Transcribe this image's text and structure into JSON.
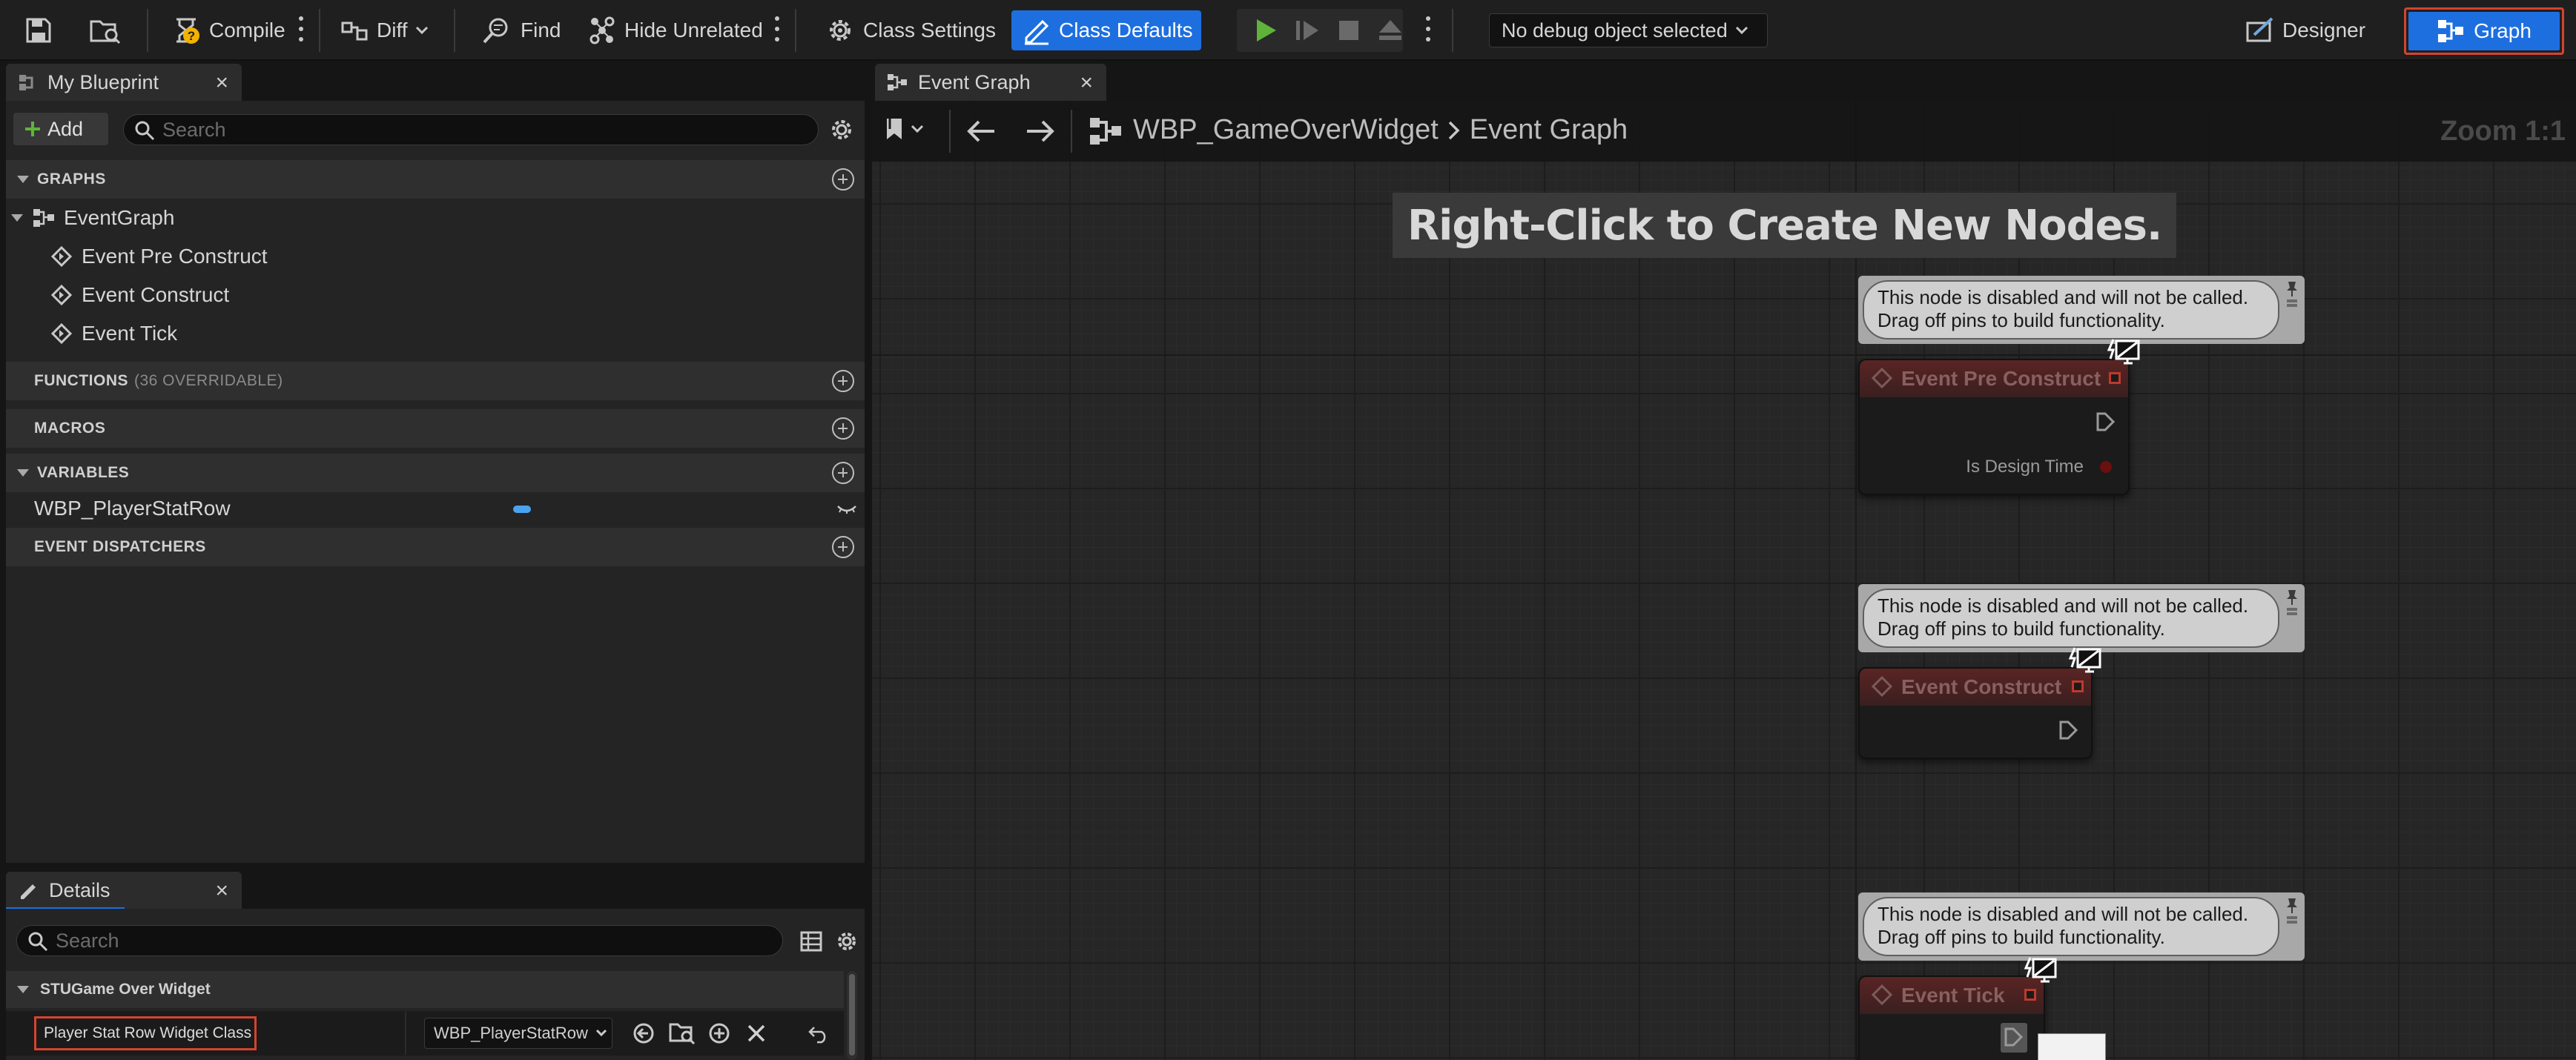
{
  "toolbar": {
    "compile_label": "Compile",
    "diff_label": "Diff",
    "find_label": "Find",
    "hide_unrelated_label": "Hide Unrelated",
    "class_settings_label": "Class Settings",
    "class_defaults_label": "Class Defaults",
    "debug_select_label": "No debug object selected",
    "designer_label": "Designer",
    "graph_label": "Graph"
  },
  "my_blueprint": {
    "tab_label": "My Blueprint",
    "add_label": "Add",
    "search_placeholder": "Search",
    "sections": {
      "graphs": "GRAPHS",
      "functions": "FUNCTIONS",
      "functions_note": "(36 OVERRIDABLE)",
      "macros": "MACROS",
      "variables": "VARIABLES",
      "event_dispatchers": "EVENT DISPATCHERS"
    },
    "graph_items": {
      "root": "EventGraph",
      "children": [
        "Event Pre Construct",
        "Event Construct",
        "Event Tick"
      ]
    },
    "variables": [
      {
        "name": "WBP_PlayerStatRow",
        "type_color": "#4aa3f0"
      }
    ]
  },
  "details": {
    "tab_label": "Details",
    "search_placeholder": "Search",
    "category": "STUGame Over Widget",
    "property_label": "Player Stat Row Widget Class",
    "property_value": "WBP_PlayerStatRow"
  },
  "graph": {
    "tab_label": "Event Graph",
    "breadcrumb_blueprint": "WBP_GameOverWidget",
    "breadcrumb_graph": "Event Graph",
    "zoom_label": "Zoom 1:1",
    "hint": "Right-Click to Create New Nodes.",
    "comment_text": [
      "This node is disabled and will not be called.",
      "Drag off pins to build functionality."
    ],
    "nodes": [
      {
        "title": "Event Pre Construct",
        "pin_label": "Is Design Time"
      },
      {
        "title": "Event Construct"
      },
      {
        "title": "Event Tick"
      }
    ]
  },
  "colors": {
    "accent_blue": "#1d6fe0",
    "highlight_red": "#d5432e",
    "play_green": "#5fb33a",
    "node_header": "#5a2424"
  }
}
